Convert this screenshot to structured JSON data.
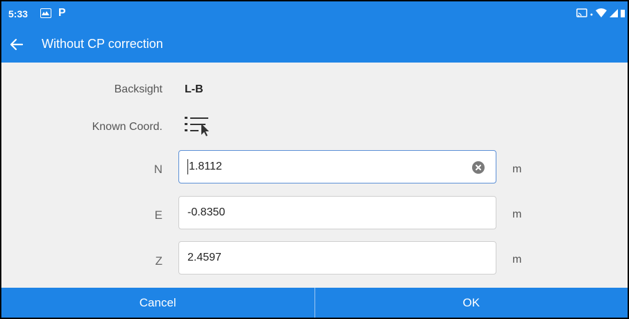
{
  "status_bar": {
    "time": "5:33",
    "app_icons": [
      "gallery-icon",
      "p-icon"
    ],
    "p_label": "P",
    "right_icons": [
      "cast-icon",
      "wifi-icon",
      "signal-icon",
      "battery-icon"
    ]
  },
  "app_bar": {
    "title": "Without CP correction",
    "back_icon": "arrow-left-icon"
  },
  "form": {
    "backsight_label": "Backsight",
    "backsight_value": "L-B",
    "known_coord_label": "Known Coord.",
    "known_coord_icon": "list-select-icon",
    "fields": [
      {
        "label": "N",
        "value": "1.8112",
        "unit": "m",
        "focused": true
      },
      {
        "label": "E",
        "value": "-0.8350",
        "unit": "m"
      },
      {
        "label": "Z",
        "value": "2.4597",
        "unit": "m"
      }
    ]
  },
  "buttons": {
    "cancel": "Cancel",
    "ok": "OK"
  },
  "colors": {
    "primary": "#1e84e6",
    "background": "#f0f0f0"
  }
}
